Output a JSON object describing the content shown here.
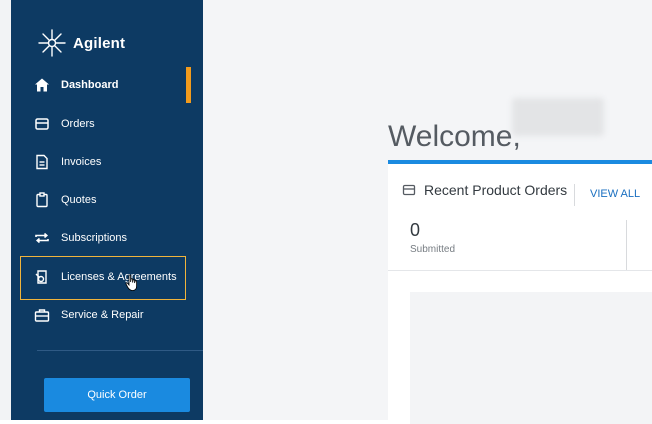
{
  "brand": {
    "name": "Agilent"
  },
  "sidebar": {
    "items": [
      {
        "label": "Dashboard",
        "icon": "home-icon"
      },
      {
        "label": "Orders",
        "icon": "box-icon"
      },
      {
        "label": "Invoices",
        "icon": "document-icon"
      },
      {
        "label": "Quotes",
        "icon": "clipboard-icon"
      },
      {
        "label": "Subscriptions",
        "icon": "repeat-icon"
      },
      {
        "label": "Licenses & Agreements",
        "icon": "license-icon"
      },
      {
        "label": "Service & Repair",
        "icon": "toolbox-icon"
      }
    ],
    "quick_order_label": "Quick Order"
  },
  "main": {
    "welcome": "Welcome,",
    "card": {
      "title": "Recent Product Orders",
      "view_all": "VIEW ALL",
      "stat_value": "0",
      "stat_label": "Submitted"
    }
  },
  "colors": {
    "sidebar_bg": "#0d3a63",
    "accent_orange": "#f29b1d",
    "primary_blue": "#1a8ae0",
    "highlight": "#f0b43c"
  }
}
